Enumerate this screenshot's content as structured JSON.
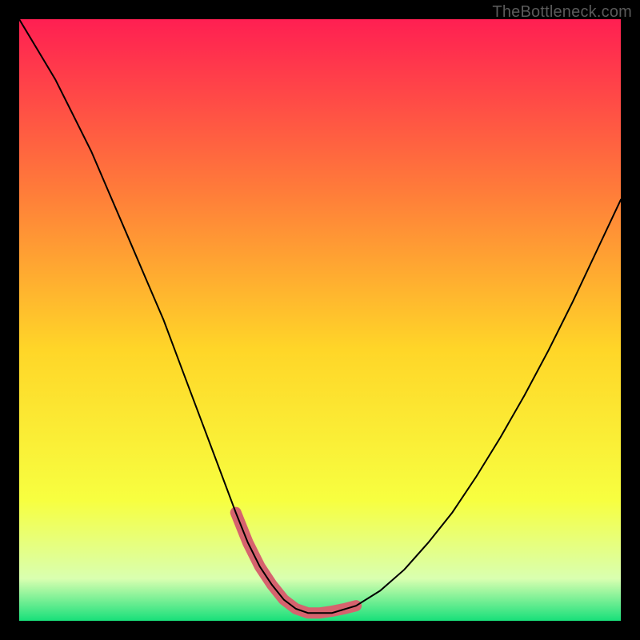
{
  "watermark": "TheBottleneck.com",
  "colors": {
    "gradient_top": "#ff1f52",
    "gradient_mid_upper": "#ff7a3a",
    "gradient_mid": "#ffd628",
    "gradient_mid_lower": "#f7ff40",
    "gradient_low": "#d9ffb0",
    "gradient_bottom": "#18e07a",
    "curve": "#000000",
    "accent": "#d6636e",
    "frame": "#000000"
  },
  "chart_data": {
    "type": "line",
    "title": "",
    "xlabel": "",
    "ylabel": "",
    "xlim": [
      0,
      100
    ],
    "ylim": [
      0,
      100
    ],
    "grid": false,
    "legend": false,
    "annotations": [
      {
        "text": "TheBottleneck.com",
        "position": "top-right"
      }
    ],
    "series": [
      {
        "name": "bottleneck-curve",
        "x": [
          0,
          3,
          6,
          9,
          12,
          15,
          18,
          21,
          24,
          27,
          30,
          33,
          36,
          38,
          40,
          42,
          44,
          46,
          48,
          52,
          56,
          60,
          64,
          68,
          72,
          76,
          80,
          84,
          88,
          92,
          96,
          100
        ],
        "y": [
          100,
          95,
          90,
          84,
          78,
          71,
          64,
          57,
          50,
          42,
          34,
          26,
          18,
          13,
          9,
          6,
          3.5,
          2,
          1.3,
          1.3,
          2.5,
          5,
          8.5,
          13,
          18,
          24,
          30.5,
          37.5,
          45,
          53,
          61.5,
          70
        ]
      }
    ],
    "accent_region": {
      "name": "optimal-range",
      "x": [
        36,
        38,
        40,
        42,
        44,
        46,
        48,
        50,
        52,
        54,
        56
      ],
      "y": [
        18,
        13,
        9,
        6,
        3.5,
        2,
        1.3,
        1.3,
        1.6,
        2,
        2.5
      ]
    }
  }
}
